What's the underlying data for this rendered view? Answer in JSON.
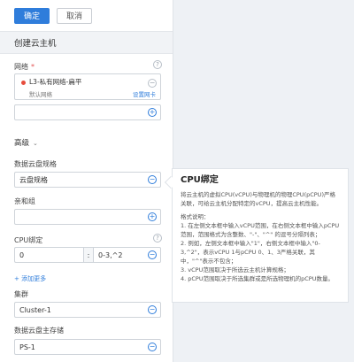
{
  "toolbar": {
    "confirm_label": "确定",
    "cancel_label": "取消"
  },
  "section": {
    "title": "创建云主机"
  },
  "network": {
    "label": "网络",
    "required_mark": "*",
    "help_icon": "?",
    "selected_name": "L3-私有网络-扁平",
    "default_text": "默认网络",
    "set_nic_label": "设置网卡",
    "remove_icon": "−",
    "add_icon": "+"
  },
  "advanced": {
    "label": "高级",
    "chevron": "⌄"
  },
  "data_disk_offering": {
    "label": "数据云盘规格",
    "value": "云盘规格",
    "remove_icon": "−"
  },
  "affinity_group": {
    "label": "亲和组",
    "value": "",
    "add_icon": "+"
  },
  "cpu_pinning": {
    "label": "CPU绑定",
    "help_icon": "?",
    "vcpu_value": "0",
    "separator": ":",
    "pcpu_value": "0-3,^2",
    "remove_icon": "−",
    "add_more_label": "+ 添加更多"
  },
  "cluster": {
    "label": "集群",
    "value": "Cluster-1",
    "remove_icon": "−"
  },
  "data_disk_storage": {
    "label": "数据云盘主存储",
    "value": "PS-1",
    "remove_icon": "−"
  },
  "tooltip": {
    "title": "CPU绑定",
    "intro": "将云主机的虚拟CPU(vCPU)与物理机的物理CPU(pCPU)严格关联，可给云主机分配特定的vCPU，提高云主机性能。",
    "format_heading": "格式说明：",
    "line1": "1. 在左侧文本框中输入vCPU范围，在右侧文本框中输入pCPU范围，范围格式为含整数、\"-\"、\"^\" 的逗号分隔列表；",
    "line2": "2. 例如，左侧文本框中输入\"1\"，右侧文本框中输入\"0-3,^2\"，表示vCPU 1与pCPU 0、1、3严格关联，其中，\"^\"表示不包含；",
    "line3": "3. vCPU范围取决于所选云主机计算规格；",
    "line4": "4. pCPU范围取决于所选集群或是所选物理机的pCPU数量。"
  },
  "colors": {
    "accent": "#2f7ddb",
    "required": "#e25151",
    "network_dot": "#e74c3c"
  }
}
